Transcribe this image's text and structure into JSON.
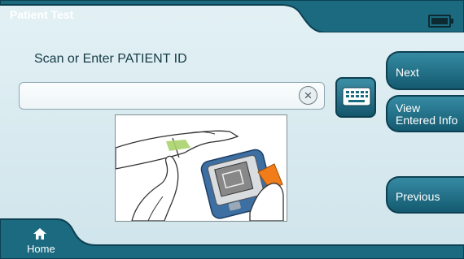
{
  "header": {
    "title": "Patient Test",
    "battery_icon": "battery-full-icon"
  },
  "main": {
    "prompt": "Scan or Enter PATIENT ID",
    "patient_id_value": "",
    "clear_icon": "clear-x-icon",
    "keyboard_icon": "keyboard-icon"
  },
  "side": {
    "next_label": "Next",
    "view_label": "View\nEntered Info",
    "previous_label": "Previous"
  },
  "footer": {
    "home_label": "Home",
    "home_icon": "home-icon"
  },
  "colors": {
    "primary": "#1b6a80",
    "dark": "#0d4051",
    "background": "#d7e9ef",
    "accent": "#f07d1a"
  }
}
